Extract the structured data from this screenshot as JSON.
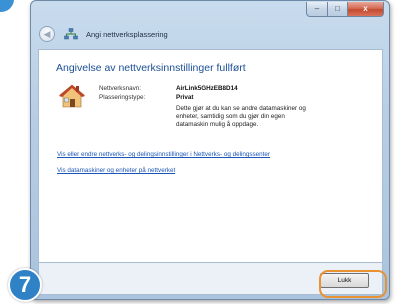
{
  "window": {
    "title": "Angi nettverksplassering",
    "controls": {
      "minimize": "–",
      "maximize": "□",
      "close": "x"
    }
  },
  "content": {
    "heading": "Angivelse av nettverksinnstillinger fullført",
    "network": {
      "name_label": "Nettverksnavn:",
      "name_value": "AirLink5GHzEB8D14",
      "type_label": "Plasseringstype:",
      "type_value": "Privat"
    },
    "description": "Dette gjør at du kan se andre datamaskiner og enheter, samtidig som du gjør din egen datamaskin mulig å oppdage.",
    "links": [
      "Vis eller endre nettverks- og delingsinnstillinger i Nettverks- og delingssenter",
      "Vis datamaskiner og enheter på nettverket"
    ]
  },
  "footer": {
    "close_label": "Lukk"
  },
  "step": {
    "number": "7"
  },
  "colors": {
    "heading": "#1b4f96",
    "link": "#1a56b8",
    "step_badge": "#2f82c6",
    "highlight": "#e99234"
  },
  "icons": {
    "nav_icon": "network-icon",
    "back": "back-arrow-icon",
    "location": "house-icon"
  }
}
